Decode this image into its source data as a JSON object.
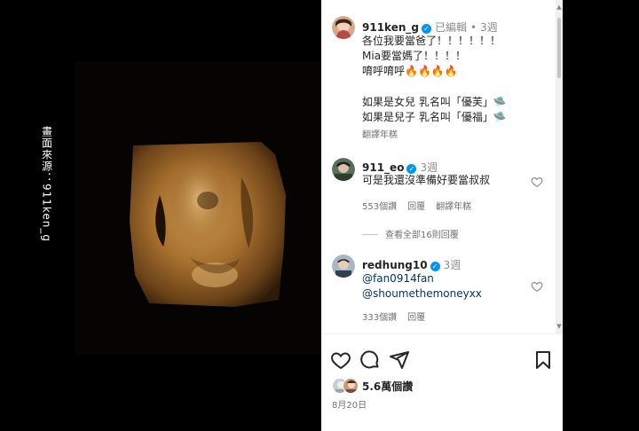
{
  "left": {
    "side_caption": "畫面來源：911ken_g"
  },
  "post": {
    "author": "911ken_g",
    "edited": "已編輯",
    "separator": "•",
    "time": "3週",
    "caption_lines": [
      "各位我要當爸了！！！！！！",
      "Mia要當媽了！！！！",
      "唷呼唷呼🔥🔥🔥🔥"
    ],
    "caption_lines_2": [
      "如果是女兒 乳名叫「優芙」🛸",
      "如果是兒子 乳名叫「優福」🛸"
    ],
    "translate": "翻譯年糕"
  },
  "comments": [
    {
      "username": "911_eo",
      "time": "3週",
      "text": "可是我還沒準備好要當叔叔",
      "likes": "553個讚",
      "reply": "回覆",
      "translate": "翻譯年糕"
    },
    {
      "username": "redhung10",
      "time": "3週",
      "lines": [
        "@fan0914fan",
        "@shoumethemoneyxx"
      ],
      "likes": "333個讚",
      "reply": "回覆"
    }
  ],
  "view_replies": "查看全部16則回覆",
  "footer": {
    "likes": "5.6萬個讚",
    "date": "8月20日"
  },
  "colors": {
    "verified": "#0095f6",
    "mention": "#00376b",
    "meta": "#737373",
    "background": "#ffffff"
  },
  "icons": [
    "heart-icon",
    "comment-icon",
    "share-icon",
    "bookmark-icon",
    "verified-icon",
    "small-heart-icon"
  ]
}
